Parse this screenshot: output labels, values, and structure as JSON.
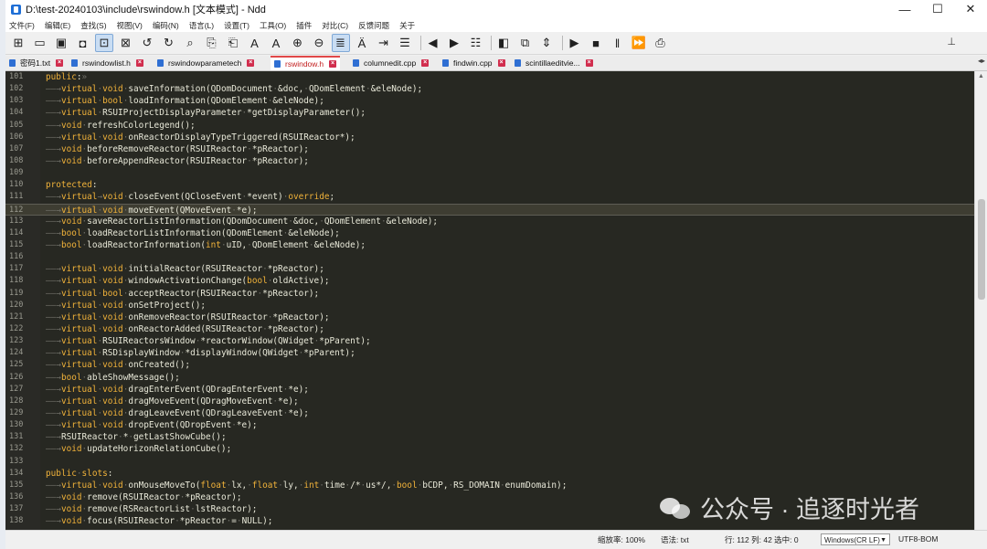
{
  "window": {
    "title": "D:\\test-20240103\\include\\rswindow.h [文本模式] - Ndd",
    "minimize": "—",
    "maximize": "☐",
    "close": "✕"
  },
  "menu": [
    "文件(F)",
    "编辑(E)",
    "查找(S)",
    "视图(V)",
    "编码(N)",
    "语言(L)",
    "设置(T)",
    "工具(O)",
    "插件",
    "对比(C)",
    "反馈问题",
    "关于"
  ],
  "tabs": [
    {
      "label": "密码1.txt",
      "active": false
    },
    {
      "label": "rswindowlist.h",
      "active": false
    },
    {
      "label": "rswindowparametech",
      "active": false
    },
    {
      "label": "rswindow.h",
      "active": true
    },
    {
      "label": "columnedit.cpp",
      "active": false
    },
    {
      "label": "findwin.cpp",
      "active": false
    },
    {
      "label": "scintillaeditvie...",
      "active": false
    }
  ],
  "current_line": 112,
  "lines": [
    {
      "n": "101",
      "code": "public:»"
    },
    {
      "n": "102",
      "code": "——→virtual·void·saveInformation(QDomDocument·&doc,·QDomElement·&eleNode);"
    },
    {
      "n": "103",
      "code": "——→virtual·bool·loadInformation(QDomElement·&eleNode);"
    },
    {
      "n": "104",
      "code": "——→virtual·RSUIProjectDisplayParameter·*getDisplayParameter();"
    },
    {
      "n": "105",
      "code": "——→void·refreshColorLegend();"
    },
    {
      "n": "106",
      "code": "——→virtual·void·onReactorDisplayTypeTriggered(RSUIReactor*);"
    },
    {
      "n": "107",
      "code": "——→void·beforeRemoveReactor(RSUIReactor·*pReactor);"
    },
    {
      "n": "108",
      "code": "——→void·beforeAppendReactor(RSUIReactor·*pReactor);"
    },
    {
      "n": "109",
      "code": ""
    },
    {
      "n": "110",
      "code": "protected:"
    },
    {
      "n": "111",
      "code": "——→virtual→void·closeEvent(QCloseEvent·*event)·override;"
    },
    {
      "n": "112",
      "code": "——→virtual·void·moveEvent(QMoveEvent·*e);"
    },
    {
      "n": "113",
      "code": "——→void·saveReactorListInformation(QDomDocument·&doc,·QDomElement·&eleNode);"
    },
    {
      "n": "114",
      "code": "——→bool·loadReactorListInformation(QDomElement·&eleNode);"
    },
    {
      "n": "115",
      "code": "——→bool·loadReactorInformation(int·uID,·QDomElement·&eleNode);"
    },
    {
      "n": "116",
      "code": ""
    },
    {
      "n": "117",
      "code": "——→virtual·void·initialReactor(RSUIReactor·*pReactor);"
    },
    {
      "n": "118",
      "code": "——→virtual·void·windowActivationChange(bool·oldActive);"
    },
    {
      "n": "119",
      "code": "——→virtual·bool·acceptReactor(RSUIReactor·*pReactor);"
    },
    {
      "n": "120",
      "code": "——→virtual·void·onSetProject();"
    },
    {
      "n": "121",
      "code": "——→virtual·void·onRemoveReactor(RSUIReactor·*pReactor);"
    },
    {
      "n": "122",
      "code": "——→virtual·void·onReactorAdded(RSUIReactor·*pReactor);"
    },
    {
      "n": "123",
      "code": "——→virtual·RSUIReactorsWindow·*reactorWindow(QWidget·*pParent);"
    },
    {
      "n": "124",
      "code": "——→virtual·RSDisplayWindow·*displayWindow(QWidget·*pParent);"
    },
    {
      "n": "125",
      "code": "——→virtual·void·onCreated();"
    },
    {
      "n": "126",
      "code": "——→bool·ableShowMessage();"
    },
    {
      "n": "127",
      "code": "——→virtual·void·dragEnterEvent(QDragEnterEvent·*e);"
    },
    {
      "n": "128",
      "code": "——→virtual·void·dragMoveEvent(QDragMoveEvent·*e);"
    },
    {
      "n": "129",
      "code": "——→virtual·void·dragLeaveEvent(QDragLeaveEvent·*e);"
    },
    {
      "n": "130",
      "code": "——→virtual·void·dropEvent(QDropEvent·*e);"
    },
    {
      "n": "131",
      "code": "——→RSUIReactor·*·getLastShowCube();"
    },
    {
      "n": "132",
      "code": "——→void·updateHorizonRelationCube();"
    },
    {
      "n": "133",
      "code": ""
    },
    {
      "n": "134",
      "code": "public·slots:"
    },
    {
      "n": "135",
      "code": "——→virtual·void·onMouseMoveTo(float·lx,·float·ly,·int·time·/*·us*/,·bool·bCDP,·RS_DOMAIN·enumDomain);"
    },
    {
      "n": "136",
      "code": "——→void·remove(RSUIReactor·*pReactor);"
    },
    {
      "n": "137",
      "code": "——→void·remove(RSReactorList·lstReactor);"
    },
    {
      "n": "138",
      "code": "——→void·focus(RSUIReactor·*pReactor·=·NULL);"
    }
  ],
  "status": {
    "zoom": "缩放率: 100%",
    "lang": "语法: txt",
    "position": "行: 112 列: 42 选中: 0",
    "eol": "Windows(CR LF)",
    "encoding": "UTF8-BOM"
  },
  "watermark": "公众号 · 追逐时光者",
  "colors": {
    "editor_bg": "#272822",
    "keyword": "#f0b23a",
    "tab_arrow": "#6f6f68",
    "active_tab": "#e14949"
  }
}
